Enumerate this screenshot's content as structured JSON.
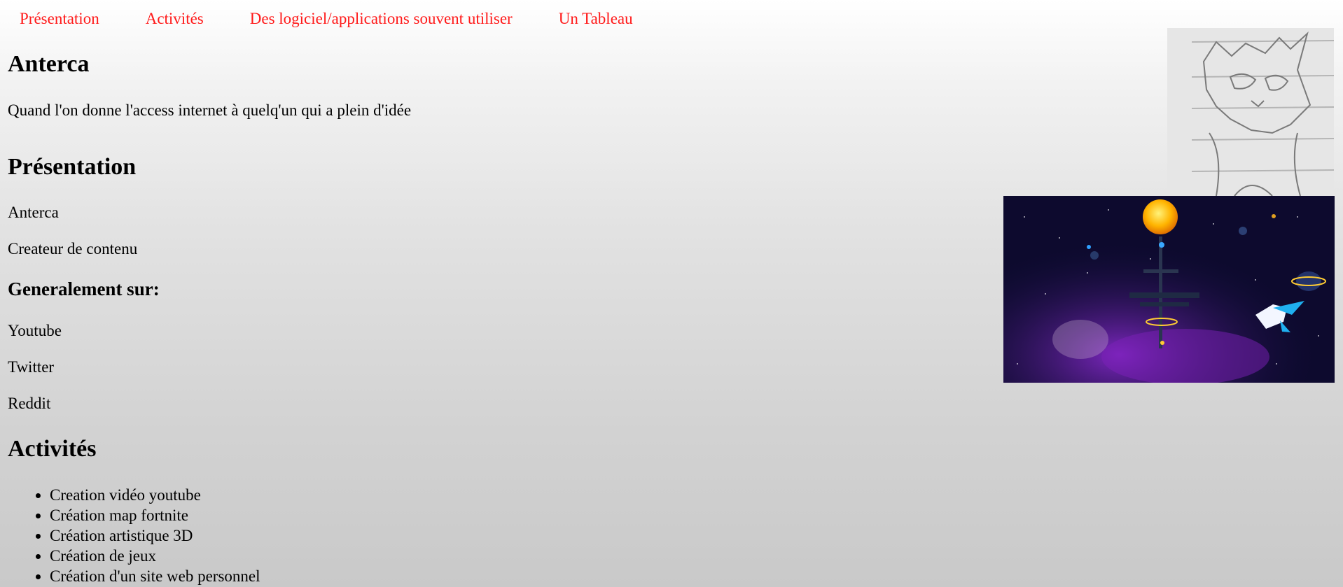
{
  "nav": {
    "items": [
      {
        "label": "Présentation"
      },
      {
        "label": "Activités"
      },
      {
        "label": "Des logiciel/applications souvent utiliser"
      },
      {
        "label": "Un Tableau"
      }
    ]
  },
  "header": {
    "title": "Anterca",
    "tagline": "Quand l'on donne l'access internet à quelq'un qui a plein d'idée"
  },
  "presentation": {
    "heading": "Présentation",
    "name": "Anterca",
    "role": "Createur de contenu",
    "platforms_heading": "Generalement sur:",
    "platforms": [
      "Youtube",
      "Twitter",
      "Reddit"
    ]
  },
  "activites": {
    "heading": "Activités",
    "items": [
      "Creation vidéo youtube",
      "Création map fortnite",
      "Création artistique 3D",
      "Création de jeux",
      "Création d'un site web personnel"
    ]
  },
  "colors": {
    "nav_link": "#ff1a1a",
    "text": "#000000",
    "background_top": "#ffffff",
    "background_bottom": "#c9c9c9"
  }
}
